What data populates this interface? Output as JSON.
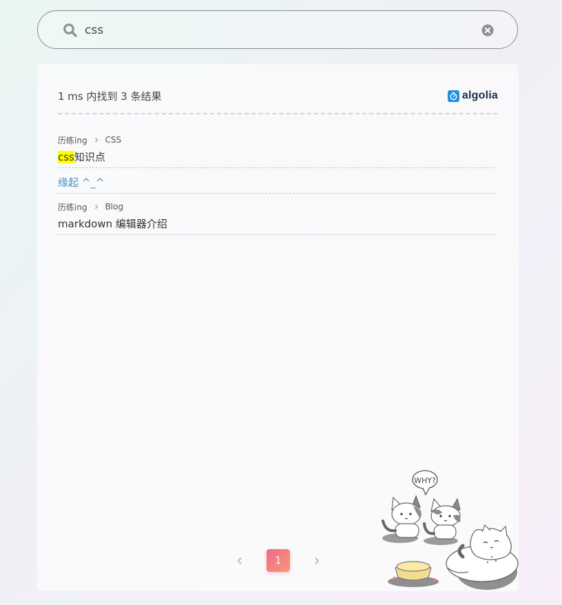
{
  "search": {
    "query": "css",
    "placeholder": ""
  },
  "results": {
    "stats": "1 ms 内找到 3 条结果",
    "brand": "algolia",
    "hits": [
      {
        "breadcrumb": [
          "历练ing",
          "CSS"
        ],
        "title_highlight": "css",
        "title_rest": "知识点"
      },
      {
        "breadcrumb": [],
        "title": "缘起 ^_^"
      },
      {
        "breadcrumb": [
          "历练ing",
          "Blog"
        ],
        "title": "markdown 编辑器介绍"
      }
    ]
  },
  "pagination": {
    "current_page": "1",
    "prev_icon": "chevron-left-icon",
    "next_icon": "chevron-right-icon"
  },
  "illustration": {
    "speech_text": "WHY?"
  },
  "colors": {
    "highlight": "#ffff00",
    "link": "#4a90c0",
    "algolia_blue": "#1e8fe1",
    "page_active_start": "#f06a8c",
    "page_active_end": "#f39a73"
  }
}
